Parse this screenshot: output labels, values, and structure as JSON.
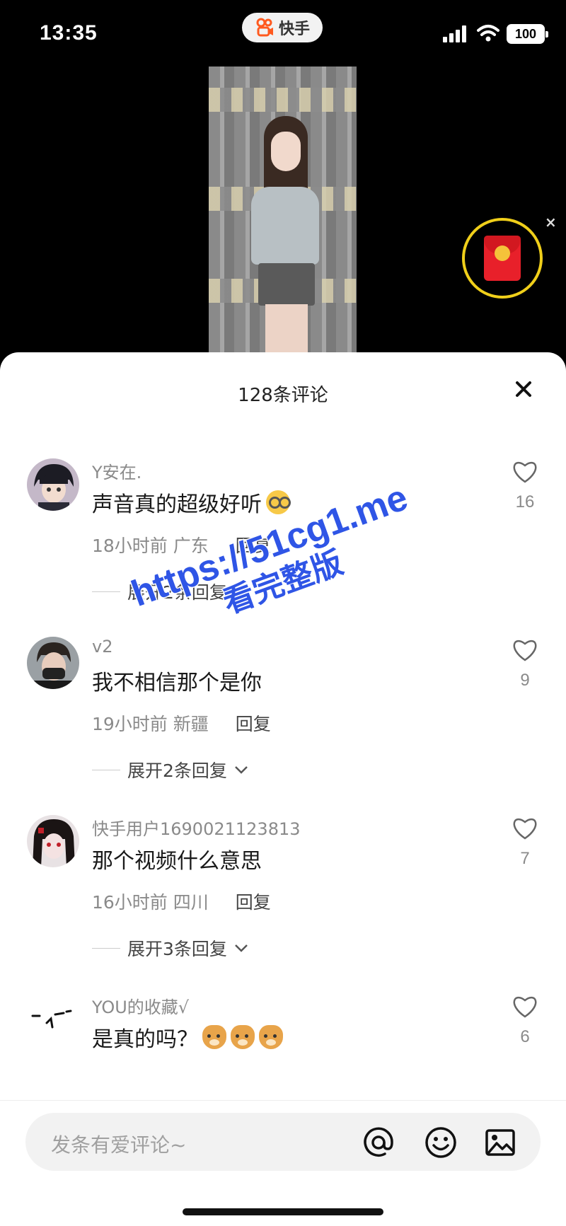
{
  "status_bar": {
    "time": "13:35",
    "app_name": "快手",
    "battery": "100"
  },
  "sheet": {
    "title": "128条评论"
  },
  "comments": [
    {
      "user": "Y安在.",
      "text": "声音真的超级好听",
      "emoji": "nerd-face",
      "time": "18小时前",
      "location": "广东",
      "reply_label": "回复",
      "expand": "展开2条回复",
      "likes": "16"
    },
    {
      "user": "v2",
      "text": "我不相信那个是你",
      "time": "19小时前",
      "location": "新疆",
      "reply_label": "回复",
      "expand": "展开2条回复",
      "likes": "9"
    },
    {
      "user": "快手用户1690021123813",
      "text": "那个视频什么意思",
      "time": "16小时前",
      "location": "四川",
      "reply_label": "回复",
      "expand": "展开3条回复",
      "likes": "7"
    },
    {
      "user": "YOU的收藏√",
      "text": "是真的吗？",
      "emoji": "dog-face x3",
      "likes": "6"
    }
  ],
  "watermark": {
    "line1": "https://51cg1.me",
    "line2": "看完整版"
  },
  "composer": {
    "placeholder": "发条有爱评论~"
  },
  "colors": {
    "accent_ring": "#f0cf1a",
    "red_packet": "#e8202a",
    "watermark": "#2f55e6"
  }
}
